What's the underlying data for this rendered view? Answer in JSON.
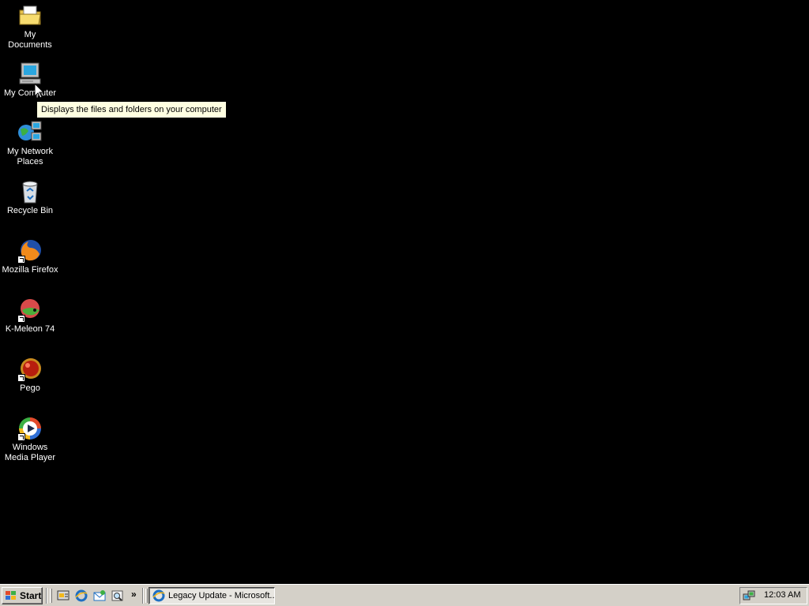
{
  "desktop": {
    "icons": [
      {
        "label": "My Documents",
        "icon": "my-documents-icon"
      },
      {
        "label": "My Computer",
        "icon": "my-computer-icon"
      },
      {
        "label_line1": "My Network",
        "label_line2": "Places",
        "icon": "my-network-places-icon"
      },
      {
        "label": "Recycle Bin",
        "icon": "recycle-bin-icon"
      },
      {
        "label": "Mozilla Firefox",
        "icon": "firefox-icon"
      },
      {
        "label": "K-Meleon 74",
        "icon": "k-meleon-icon"
      },
      {
        "label": "Pego",
        "icon": "pego-icon"
      },
      {
        "label_line1": "Windows",
        "label_line2": "Media Player",
        "icon": "windows-media-player-icon"
      }
    ],
    "background_color": "#000000"
  },
  "tooltip": {
    "text": "Displays the files and folders on your computer"
  },
  "taskbar": {
    "start_label": "Start",
    "quick_launch": [
      {
        "icon": "show-desktop-icon"
      },
      {
        "icon": "internet-explorer-icon"
      },
      {
        "icon": "outlook-express-icon"
      },
      {
        "icon": "search-icon"
      }
    ],
    "quick_launch_more": "»",
    "tasks": [
      {
        "label": "Legacy Update - Microsoft...",
        "icon": "internet-explorer-icon",
        "active": true
      }
    ],
    "tray": {
      "icons": [
        {
          "icon": "network-connection-icon"
        }
      ],
      "clock": "12:03 AM"
    }
  },
  "colors": {
    "taskbar": "#d4d0c8",
    "tooltip_bg": "#ffffe1",
    "desktop": "#000000"
  }
}
